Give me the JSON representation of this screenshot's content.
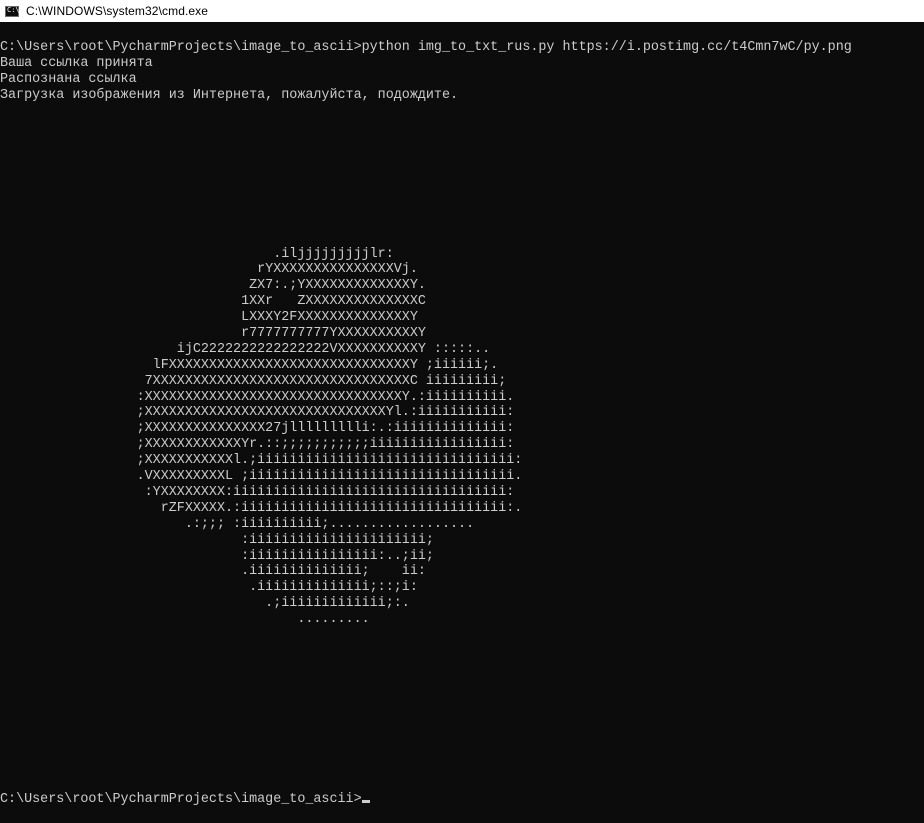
{
  "window": {
    "title": "C:\\WINDOWS\\system32\\cmd.exe",
    "icon": "cmd-console-icon",
    "icon_glyph": "C:\\"
  },
  "console": {
    "lines": [
      "C:\\Users\\root\\PycharmProjects\\image_to_ascii>python img_to_txt_rus.py https://i.postimg.cc/t4Cmn7wC/py.png",
      "Ваша ссылка принята",
      "Распознана ссылка",
      "Загрузка изображения из Интернета, пожалуйста, подождите.",
      "",
      "",
      "",
      "",
      "",
      "",
      "",
      "",
      "",
      "                                  .iljjjjjjjjjlr:",
      "                                rYXXXXXXXXXXXXXXXVj.",
      "                               ZX7:.;YXXXXXXXXXXXXXY.",
      "                              1XXr   ZXXXXXXXXXXXXXXC",
      "                              LXXXY2FXXXXXXXXXXXXXXY",
      "                              r7777777777YXXXXXXXXXXY",
      "                      ijC2222222222222222VXXXXXXXXXXY :::::..",
      "                   lFXXXXXXXXXXXXXXXXXXXXXXXXXXXXXXY ;iiiiii;.",
      "                  7XXXXXXXXXXXXXXXXXXXXXXXXXXXXXXXXC iiiiiiiii;",
      "                 :XXXXXXXXXXXXXXXXXXXXXXXXXXXXXXXXY.:iiiiiiiiii.",
      "                 ;XXXXXXXXXXXXXXXXXXXXXXXXXXXXXXYl.:iiiiiiiiiii:",
      "                 ;XXXXXXXXXXXXXXX27jllllllllli:.:iiiiiiiiiiiiii:",
      "                 ;XXXXXXXXXXXXYr.::;;;;;;;;;;;iiiiiiiiiiiiiiiii:",
      "                 ;XXXXXXXXXXXl.;iiiiiiiiiiiiiiiiiiiiiiiiiiiiiiii:",
      "                 .VXXXXXXXXXL ;iiiiiiiiiiiiiiiiiiiiiiiiiiiiiiiii.",
      "                  :YXXXXXXXX:iiiiiiiiiiiiiiiiiiiiiiiiiiiiiiiiii:",
      "                    rZFXXXXX.:iiiiiiiiiiiiiiiiiiiiiiiiiiiiiiiii:.",
      "                       .:;;; :iiiiiiiiii;..................",
      "                              :iiiiiiiiiiiiiiiiiiiiii;",
      "                              :iiiiiiiiiiiiiiii:..;ii;",
      "                              .iiiiiiiiiiiiii;    ii:",
      "                               .iiiiiiiiiiiiii;::;i:",
      "                                 .;iiiiiiiiiiiii;:.",
      "                                     ........."
    ],
    "prompt": "C:\\Users\\root\\PycharmProjects\\image_to_ascii>"
  },
  "colors": {
    "background": "#0c0c0c",
    "text": "#cccccc",
    "titlebar": "#ffffff"
  }
}
